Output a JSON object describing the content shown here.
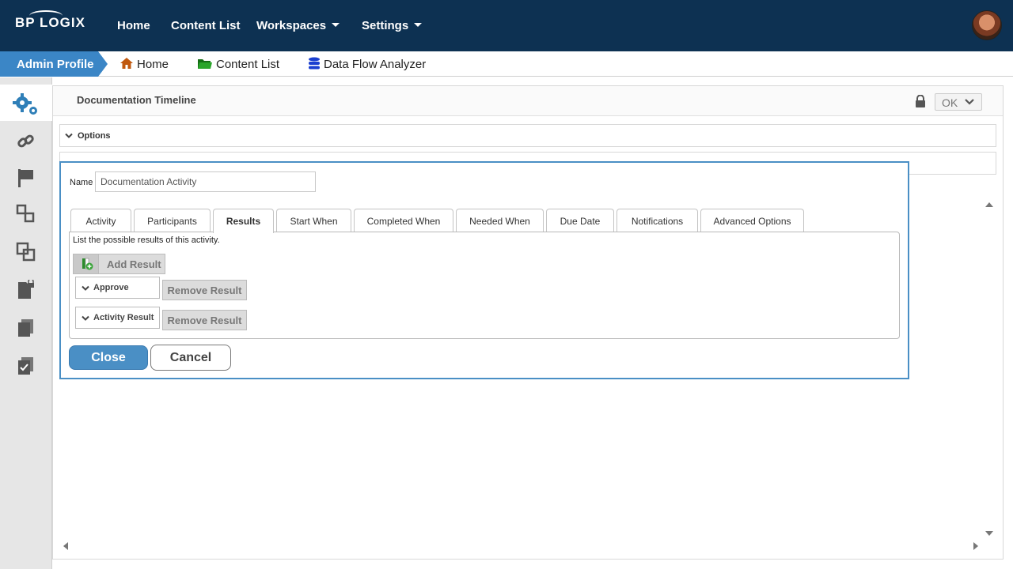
{
  "app": {
    "logo": "BP LOGIX"
  },
  "topnav": {
    "items": [
      {
        "label": "Home"
      },
      {
        "label": "Content List"
      },
      {
        "label": "Workspaces"
      },
      {
        "label": "Settings"
      }
    ]
  },
  "breadcrumb": {
    "admin_profile": "Admin Profile",
    "items": [
      {
        "label": "Home",
        "icon": "home-icon",
        "color": "#c0580e"
      },
      {
        "label": "Content List",
        "icon": "folder-icon",
        "color": "#1f8a1f"
      },
      {
        "label": "Data Flow Analyzer",
        "icon": "database-icon",
        "color": "#1a3fd0"
      }
    ]
  },
  "sidebar": {
    "items": [
      {
        "icon": "gears-icon",
        "active": true
      },
      {
        "icon": "link-icon"
      },
      {
        "icon": "flag-icon"
      },
      {
        "icon": "workflow-icon"
      },
      {
        "icon": "copy-icon"
      },
      {
        "icon": "locked-document-icon"
      },
      {
        "icon": "documents-icon"
      },
      {
        "icon": "checklist-icon"
      }
    ]
  },
  "panel": {
    "title": "Documentation Timeline",
    "ok_label": "OK",
    "options_label": "Options"
  },
  "dialog": {
    "name_label": "Name",
    "name_value": "Documentation Activity",
    "tabs": [
      {
        "label": "Activity"
      },
      {
        "label": "Participants"
      },
      {
        "label": "Results",
        "active": true
      },
      {
        "label": "Start When"
      },
      {
        "label": "Completed When"
      },
      {
        "label": "Needed When"
      },
      {
        "label": "Due Date"
      },
      {
        "label": "Notifications"
      },
      {
        "label": "Advanced Options"
      }
    ],
    "hint": "List the possible results of this activity.",
    "add_result_label": "Add Result",
    "results": [
      {
        "name": "Approve",
        "remove_label": "Remove Result"
      },
      {
        "name": "Activity Result",
        "remove_label": "Remove Result"
      }
    ],
    "close_label": "Close",
    "cancel_label": "Cancel"
  },
  "colors": {
    "topbar": "#0d3152",
    "accent": "#3b86c6",
    "dialog_border": "#4a8fc5"
  }
}
